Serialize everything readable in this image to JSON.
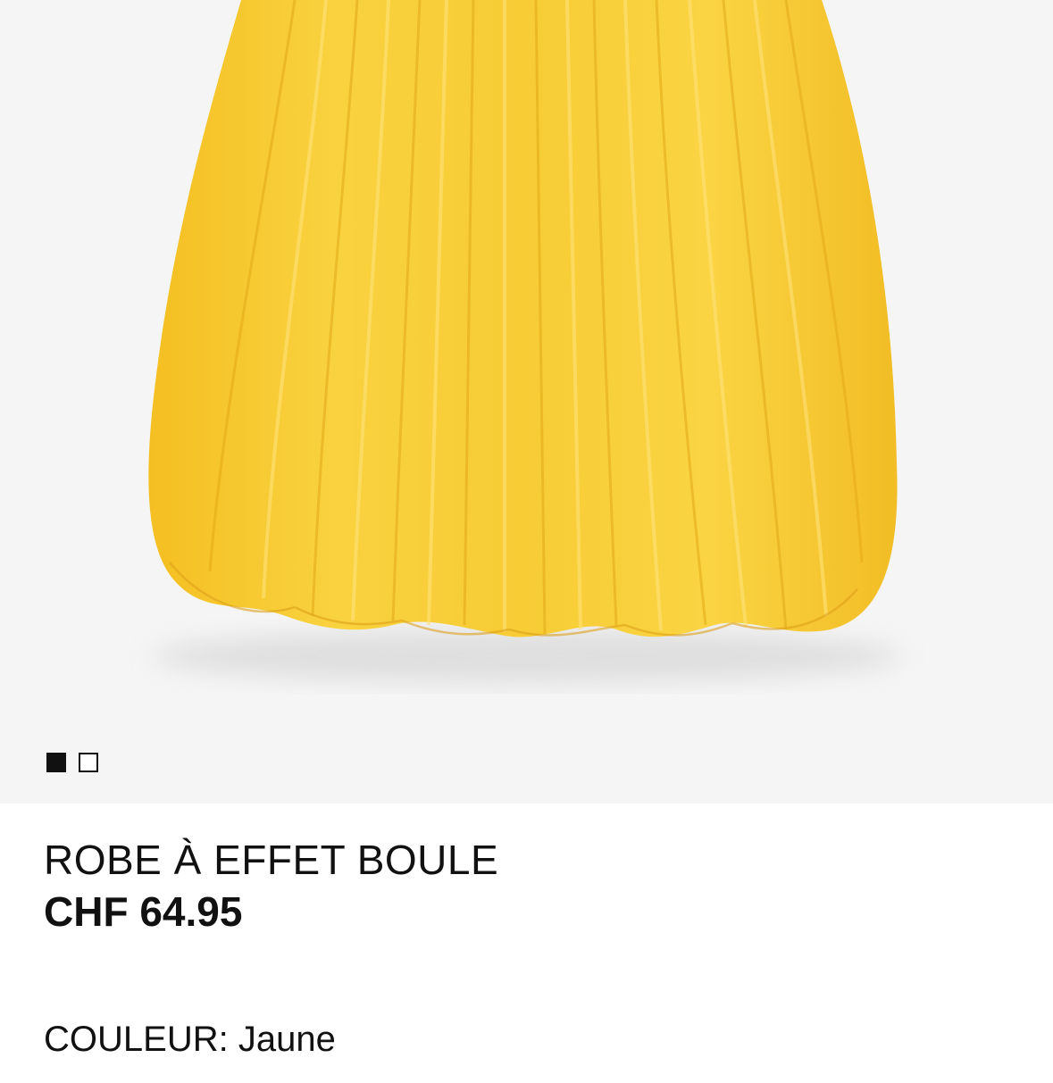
{
  "product": {
    "image_description": "yellow-bubble-dress",
    "image_count": 2,
    "active_image_index": 0,
    "title": "ROBE À EFFET BOULE",
    "price": "CHF 64.95",
    "color_label": "COULEUR:",
    "color_value": "Jaune"
  },
  "colors": {
    "dress": "#F7C932",
    "dress_shadow": "#E8B01E",
    "image_background": "#F5F5F5",
    "text": "#111111"
  }
}
